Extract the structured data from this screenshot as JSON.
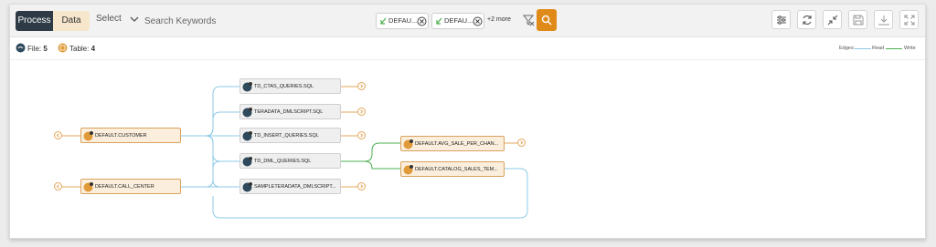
{
  "toolbar": {
    "tabs": [
      {
        "label": "Process",
        "active": true
      },
      {
        "label": "Data",
        "active": false
      }
    ],
    "select_label": "Select",
    "search_placeholder": "Search Keywords",
    "filter_chips": [
      {
        "label": "DEFAU..."
      },
      {
        "label": "DEFAU..."
      }
    ],
    "more_label": "+2 more",
    "action_icons": [
      "sliders-icon",
      "refresh-icon",
      "collapse-icon",
      "save-icon",
      "download-icon",
      "expand-icon"
    ]
  },
  "summary": {
    "file_label": "File:",
    "file_count": "5",
    "table_label": "Table:",
    "table_count": "4"
  },
  "legend": {
    "edges_label": "Edges:",
    "read_label": "Read",
    "write_label": "Write"
  },
  "colors": {
    "accent": "#e08a1a",
    "read_edge": "#8ecae6",
    "write_edge": "#4caf50",
    "table_node_bg": "#fbeedc",
    "file_node_bg": "#efefef",
    "dark": "#2e3b46"
  },
  "graph": {
    "tables_left": [
      {
        "label": "DEFAULT.CUSTOMER"
      },
      {
        "label": "DEFAULT.CALL_CENTER"
      }
    ],
    "files": [
      {
        "label": "TD_CTAS_QUERIES.SQL"
      },
      {
        "label": "TERADATA_DMLSCRIPT.SQL"
      },
      {
        "label": "TD_INSERT_QUERIES.SQL"
      },
      {
        "label": "TD_DML_QUERIES.SQL"
      },
      {
        "label": "SAMPLETERADATA_DMLSCRIPT..."
      }
    ],
    "tables_right": [
      {
        "label": "DEFAULT.AVG_SALE_PER_CHAN..."
      },
      {
        "label": "DEFAULT.CATALOG_SALES_TEM..."
      }
    ]
  }
}
